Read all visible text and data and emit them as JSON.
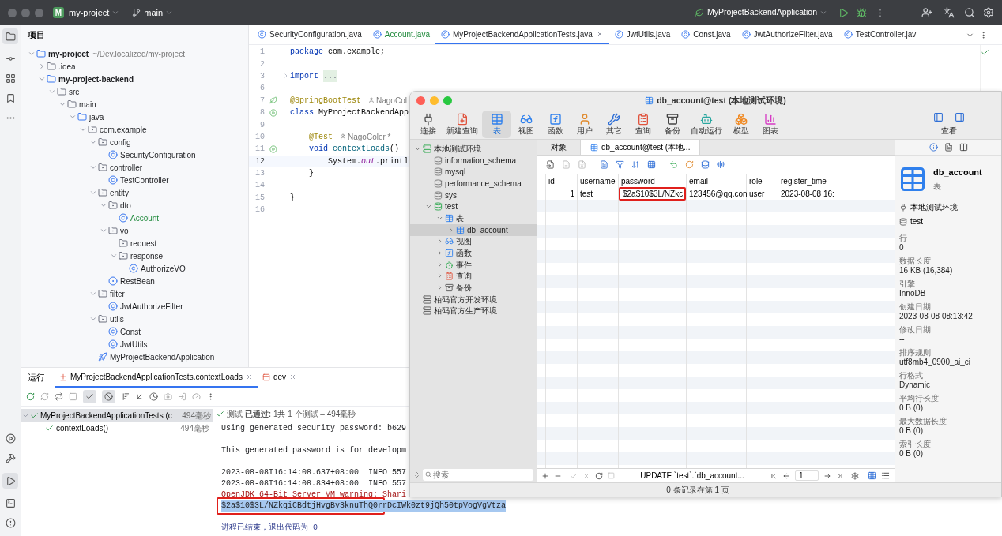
{
  "title_bar": {
    "project_badge": "M",
    "project": "my-project",
    "branch": "main",
    "run_config": "MyProjectBackendApplication"
  },
  "project_panel": {
    "title": "项目",
    "tree": [
      {
        "name": "my-project",
        "path": "~/Dev.localized/my-project",
        "kind": "module",
        "expanded": true,
        "added": false,
        "children": [
          {
            "name": ".idea",
            "kind": "dir",
            "expanded": false,
            "added": false
          },
          {
            "name": "my-project-backend",
            "kind": "module",
            "expanded": true,
            "added": false,
            "children": [
              {
                "name": "src",
                "kind": "dir",
                "expanded": true,
                "added": false,
                "children": [
                  {
                    "name": "main",
                    "kind": "dir",
                    "expanded": true,
                    "added": false,
                    "children": [
                      {
                        "name": "java",
                        "kind": "source",
                        "expanded": true,
                        "added": false,
                        "children": [
                          {
                            "name": "com.example",
                            "kind": "package",
                            "expanded": true,
                            "added": false,
                            "children": [
                              {
                                "name": "config",
                                "kind": "package",
                                "expanded": true,
                                "added": false,
                                "children": [
                                  {
                                    "name": "SecurityConfiguration",
                                    "kind": "class",
                                    "added": false
                                  }
                                ]
                              },
                              {
                                "name": "controller",
                                "kind": "package",
                                "expanded": true,
                                "added": false,
                                "children": [
                                  {
                                    "name": "TestController",
                                    "kind": "class",
                                    "added": false
                                  }
                                ]
                              },
                              {
                                "name": "entity",
                                "kind": "package",
                                "expanded": true,
                                "added": false,
                                "children": [
                                  {
                                    "name": "dto",
                                    "kind": "package",
                                    "expanded": true,
                                    "added": false,
                                    "children": [
                                      {
                                        "name": "Account",
                                        "kind": "class",
                                        "added": true
                                      }
                                    ]
                                  },
                                  {
                                    "name": "vo",
                                    "kind": "package",
                                    "expanded": true,
                                    "added": false,
                                    "children": [
                                      {
                                        "name": "request",
                                        "kind": "package",
                                        "added": false
                                      },
                                      {
                                        "name": "response",
                                        "kind": "package",
                                        "expanded": true,
                                        "added": false,
                                        "children": [
                                          {
                                            "name": "AuthorizeVO",
                                            "kind": "class",
                                            "added": false
                                          }
                                        ]
                                      }
                                    ]
                                  },
                                  {
                                    "name": "RestBean",
                                    "kind": "record",
                                    "added": false
                                  }
                                ]
                              },
                              {
                                "name": "filter",
                                "kind": "package",
                                "expanded": true,
                                "added": false,
                                "children": [
                                  {
                                    "name": "JwtAuthorizeFilter",
                                    "kind": "class",
                                    "added": false
                                  }
                                ]
                              },
                              {
                                "name": "utils",
                                "kind": "package",
                                "expanded": true,
                                "added": false,
                                "children": [
                                  {
                                    "name": "Const",
                                    "kind": "class",
                                    "added": false
                                  },
                                  {
                                    "name": "JwtUtils",
                                    "kind": "class",
                                    "added": false
                                  }
                                ]
                              },
                              {
                                "name": "MyProjectBackendApplication",
                                "kind": "app",
                                "added": false
                              }
                            ]
                          }
                        ]
                      }
                    ]
                  }
                ]
              }
            ]
          }
        ]
      }
    ]
  },
  "editor_tabs": [
    {
      "label": "SecurityConfiguration.java",
      "selected": false,
      "added": false
    },
    {
      "label": "Account.java",
      "selected": false,
      "added": true
    },
    {
      "label": "MyProjectBackendApplicationTests.java",
      "selected": true,
      "added": false
    },
    {
      "label": "JwtUtils.java",
      "selected": false,
      "added": false
    },
    {
      "label": "Const.java",
      "selected": false,
      "added": false
    },
    {
      "label": "JwtAuthorizeFilter.java",
      "selected": false,
      "added": false
    },
    {
      "label": "TestController.jav",
      "selected": false,
      "added": false
    }
  ],
  "code": [
    {
      "number": "1",
      "current": false,
      "folded": false,
      "tokens": [
        {
          "t": "package",
          "kind": "keyword"
        },
        {
          "t": "com.example;",
          "kind": "plain"
        }
      ]
    },
    {
      "number": "2",
      "current": false,
      "folded": false
    },
    {
      "number": "3",
      "current": false,
      "folded": true,
      "tokens": [
        {
          "t": "import",
          "kind": "keyword"
        },
        {
          "t": "...",
          "kind": "fold"
        }
      ]
    },
    {
      "number": "6",
      "current": false,
      "folded": false
    },
    {
      "number": "7",
      "current": false,
      "folded": false,
      "marker": {
        "kind": "spring"
      },
      "tokens": [
        {
          "t": "@SpringBootTest",
          "kind": "annotation"
        },
        {
          "t": "NagoCol",
          "kind": "author"
        }
      ]
    },
    {
      "number": "8",
      "current": false,
      "folded": false,
      "marker": {
        "kind": "run"
      },
      "tokens": [
        {
          "t": "class",
          "kind": "keyword"
        },
        {
          "t": "MyProjectBackendApp",
          "kind": "plain"
        }
      ],
      "children": [
        {
          "number": "9",
          "current": false,
          "folded": false
        },
        {
          "number": "10",
          "current": false,
          "folded": false,
          "tokens": [
            {
              "t": "@Test",
              "kind": "annotation"
            },
            {
              "t": "NagoColer *",
              "kind": "author"
            }
          ]
        },
        {
          "number": "11",
          "current": false,
          "folded": false,
          "marker": {
            "kind": "run"
          },
          "tokens": [
            {
              "t": "void",
              "kind": "keyword"
            },
            {
              "t": "contextLoads",
              "kind": "method"
            },
            {
              "t": "()",
              "kind": "plain"
            }
          ],
          "children": [
            {
              "number": "12",
              "current": true,
              "folded": false,
              "tokens": [
                {
                  "t": "System.",
                  "kind": "plain"
                },
                {
                  "t": "out",
                  "kind": "field"
                },
                {
                  "t": ".printl",
                  "kind": "plain"
                }
              ]
            }
          ]
        },
        {
          "number": "13",
          "current": false,
          "folded": false,
          "tokens": [
            {
              "t": "}",
              "kind": "plain"
            }
          ]
        },
        {
          "number": "14",
          "current": false,
          "folded": false
        }
      ]
    },
    {
      "number": "15",
      "current": false,
      "folded": false,
      "tokens": [
        {
          "t": "}",
          "kind": "plain"
        }
      ]
    },
    {
      "number": "16",
      "current": false,
      "folded": false
    }
  ],
  "run_panel": {
    "title": "运行",
    "tabs": [
      {
        "label": "MyProjectBackendApplicationTests.contextLoads",
        "selected": true
      },
      {
        "label": "dev",
        "selected": false
      }
    ],
    "toolbar": {
      "show_passed": true,
      "show_ignored": true
    },
    "tests": [
      {
        "name": "MyProjectBackendApplicationTests (c",
        "time": "494毫秒",
        "selected": true,
        "expanded": true,
        "passed": true,
        "children": [
          {
            "name": "contextLoads()",
            "time": "494毫秒",
            "selected": false,
            "passed": true
          }
        ]
      }
    ],
    "summary": "测试 **已通过:** 1共 1 个测试 – 494毫秒",
    "console": [
      {
        "text": "Using generated security password: b629",
        "kind": "output",
        "framed": false
      },
      {
        "kind": "blank",
        "framed": false
      },
      {
        "text": "This generated password is for developm",
        "kind": "output",
        "framed": false
      },
      {
        "kind": "blank",
        "framed": false
      },
      {
        "text": "2023-08-08T16:14:08.637+08:00  INFO 557",
        "kind": "output",
        "framed": false
      },
      {
        "text": "2023-08-08T16:14:08.834+08:00  INFO 557",
        "kind": "output",
        "framed": false
      },
      {
        "text": "OpenJDK 64-Bit Server VM warning: Shari",
        "kind": "warning",
        "framed": false
      },
      {
        "text": "$2a$10$3L/NZkqiCBdtjHvgBv3knuThQ0rrDcIWk0zt9jQh50tpVogVgVtza",
        "kind": "selected",
        "framed": true
      },
      {
        "kind": "blank",
        "framed": false
      },
      {
        "text": "进程已结束，退出代码为 0",
        "kind": "system",
        "framed": false
      }
    ]
  },
  "db_window": {
    "title": "db_account@test (本地测试环境)",
    "toolbar": [
      {
        "label": "连接",
        "selected": false
      },
      {
        "label": "新建查询",
        "selected": false
      },
      {
        "label": "表",
        "selected": true
      },
      {
        "label": "视图",
        "selected": false
      },
      {
        "label": "函数",
        "selected": false
      },
      {
        "label": "用户",
        "selected": false
      },
      {
        "label": "其它",
        "selected": false
      },
      {
        "label": "查询",
        "selected": false
      },
      {
        "label": "备份",
        "selected": false
      },
      {
        "label": "自动运行",
        "selected": false
      },
      {
        "label": "模型",
        "selected": false
      },
      {
        "label": "图表",
        "selected": false
      }
    ],
    "view_label": "查看",
    "tree": [
      {
        "name": "本地测试环境",
        "kind": "connection",
        "expanded": true,
        "selected": false,
        "children": [
          {
            "name": "information_schema",
            "kind": "database",
            "selected": false
          },
          {
            "name": "mysql",
            "kind": "database",
            "selected": false
          },
          {
            "name": "performance_schema",
            "kind": "database",
            "selected": false
          },
          {
            "name": "sys",
            "kind": "database",
            "selected": false
          },
          {
            "name": "test",
            "kind": "database_open",
            "expanded": true,
            "selected": false,
            "children": [
              {
                "name": "表",
                "kind": "tables",
                "expanded": true,
                "selected": false,
                "children": [
                  {
                    "name": "db_account",
                    "kind": "table",
                    "expanded": false,
                    "selected": true
                  }
                ]
              },
              {
                "name": "视图",
                "kind": "views",
                "expanded": false,
                "selected": false
              },
              {
                "name": "函数",
                "kind": "functions",
                "expanded": false,
                "selected": false
              },
              {
                "name": "事件",
                "kind": "events",
                "expanded": false,
                "selected": false
              },
              {
                "name": "查询",
                "kind": "queries",
                "expanded": false,
                "selected": false
              },
              {
                "name": "备份",
                "kind": "backups",
                "expanded": false,
                "selected": false
              }
            ]
          }
        ]
      },
      {
        "name": "柏码官方开发环境",
        "kind": "connection_idle",
        "selected": false
      },
      {
        "name": "柏码官方生产环境",
        "kind": "connection_idle",
        "selected": false
      }
    ],
    "search": {
      "placeholder": "搜索"
    },
    "tabs": [
      {
        "label": "对象",
        "selected": false
      },
      {
        "label": "db_account@test (本地...",
        "selected": true
      }
    ],
    "grid": {
      "columns": [
        "id",
        "username",
        "password",
        "email",
        "role",
        "register_time"
      ],
      "rows": [
        {
          "cells": [
            "1",
            "test",
            "$2a$10$3L/NZkc",
            "123456@qq.con",
            "user",
            "2023-08-08 16:"
          ],
          "framed": true
        }
      ]
    },
    "footer": {
      "query": "UPDATE `test`.`db_account...",
      "page": "1",
      "grid_view_selected": true
    },
    "status": "0 条记录在第 1 页",
    "info": {
      "name": "db_account",
      "type": "表",
      "connection": "本地测试环境",
      "database": "test",
      "properties": [
        {
          "label": "行",
          "value": "0"
        },
        {
          "label": "数据长度",
          "value": "16 KB (16,384)"
        },
        {
          "label": "引擎",
          "value": "InnoDB"
        },
        {
          "label": "创建日期",
          "value": "2023-08-08 08:13:42"
        },
        {
          "label": "修改日期",
          "value": "--"
        },
        {
          "label": "排序规则",
          "value": "utf8mb4_0900_ai_ci"
        },
        {
          "label": "行格式",
          "value": "Dynamic"
        },
        {
          "label": "平均行长度",
          "value": "0 B (0)"
        },
        {
          "label": "最大数据长度",
          "value": "0 B (0)"
        },
        {
          "label": "索引长度",
          "value": "0 B (0)"
        }
      ]
    }
  }
}
